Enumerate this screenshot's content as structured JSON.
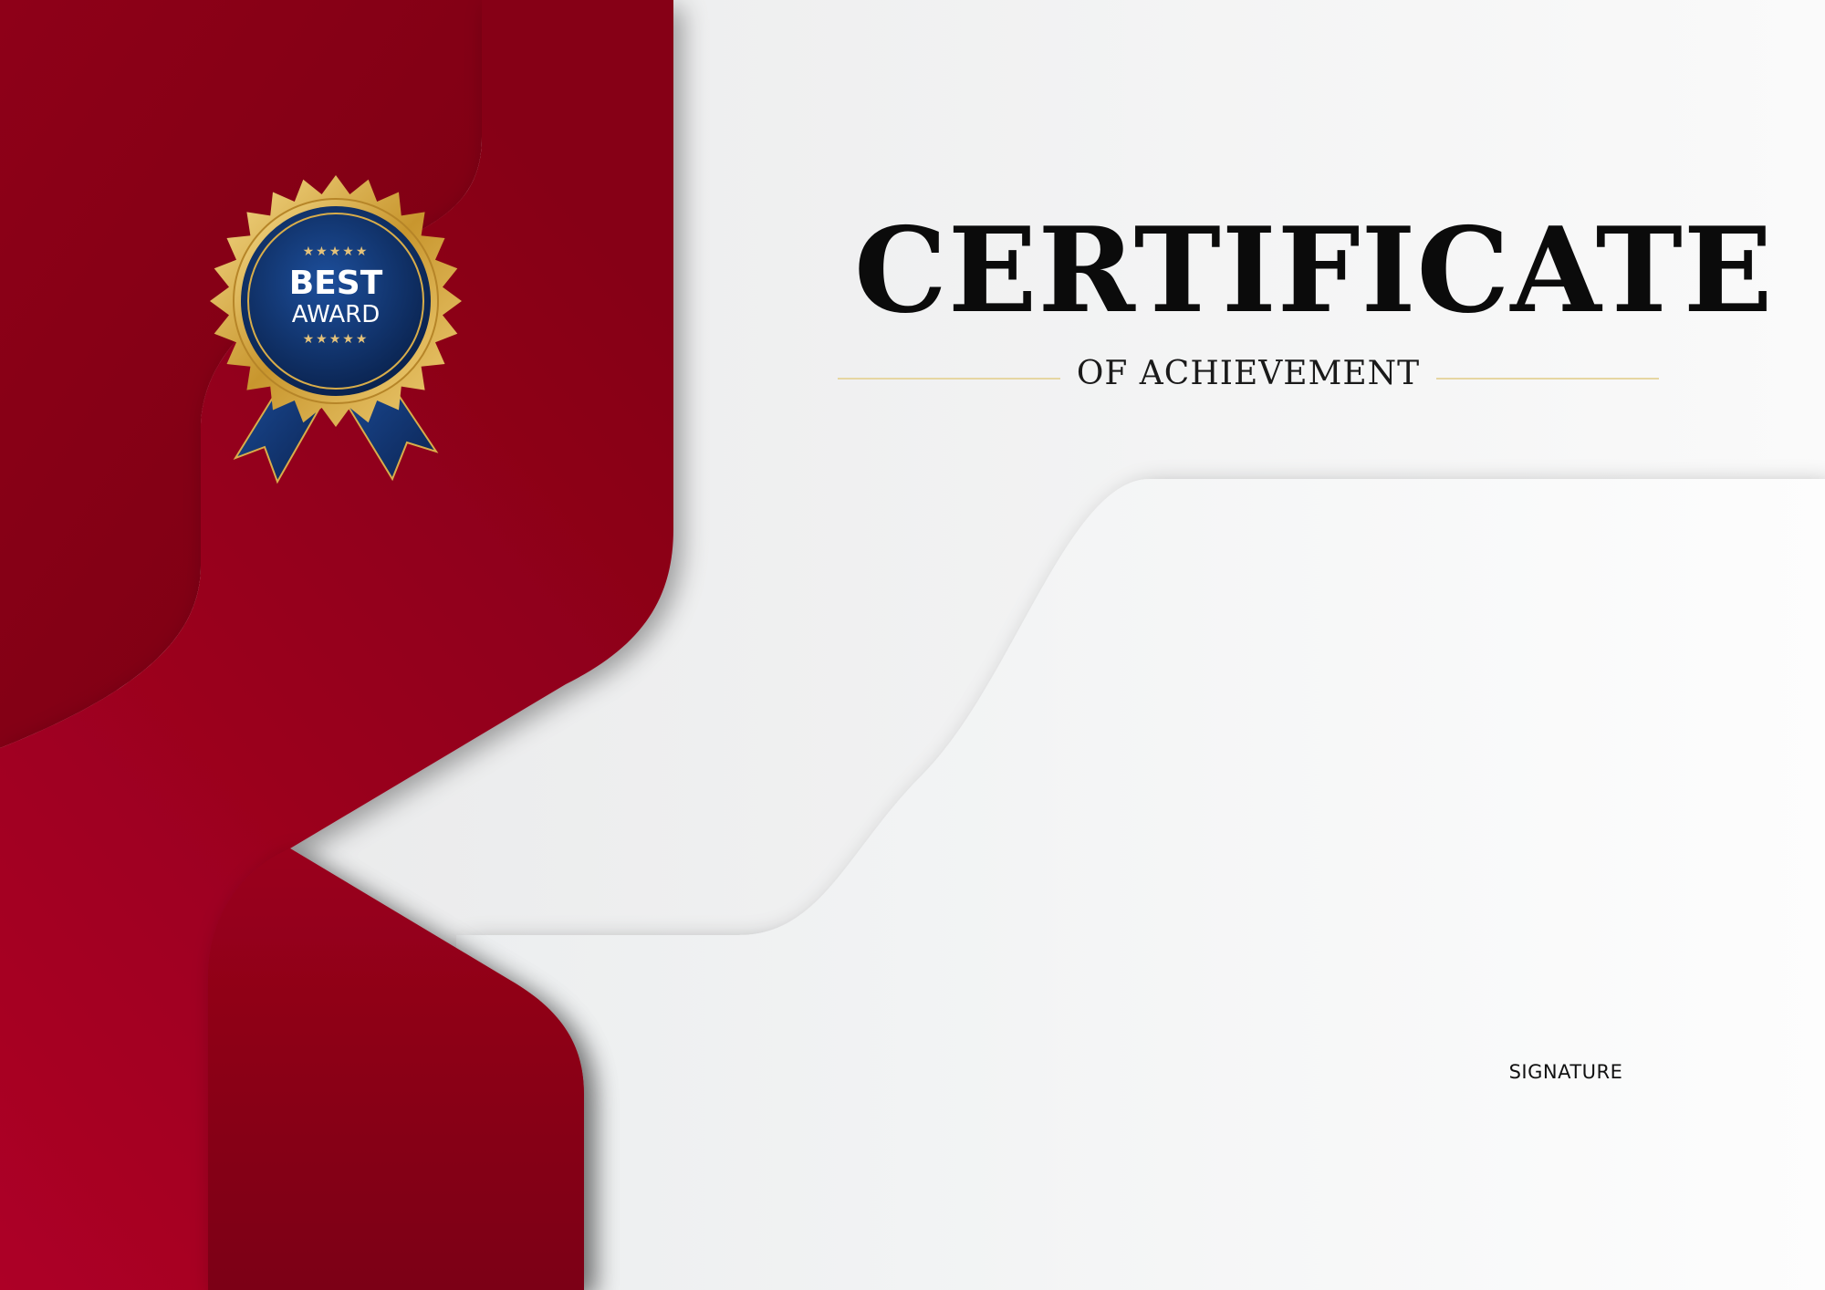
{
  "certificate": {
    "title": "CERTIFICATE",
    "subtitle": "OF ACHIEVEMENT",
    "signature_label": "SIGNATURE"
  },
  "badge": {
    "line1": "BEST",
    "line2": "AWARD",
    "stars_top": "★★★★★",
    "stars_bottom": "★★★★★",
    "icon": "award-rosette-icon"
  },
  "colors": {
    "crimson": "#a8001f",
    "dark_crimson": "#7e0014",
    "gold": "#d8ad4a",
    "navy": "#0d2c64",
    "paper": "#f4f5f6"
  }
}
